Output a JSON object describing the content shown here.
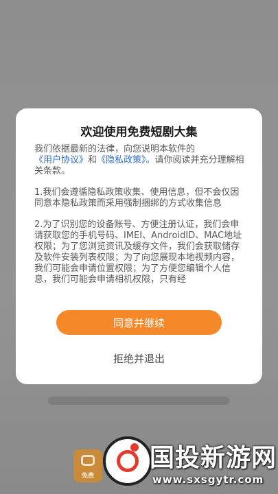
{
  "dialog": {
    "title": "欢迎使用免费短剧大集",
    "intro_before": "我们依据最新的法律，向您说明本软件的",
    "user_agreement_link": "《用户协议》",
    "and_text": "和",
    "privacy_policy_link": "《隐私政策》",
    "intro_after": "。请你阅读并充分理解相关条款。",
    "clause_1": "1.我们会遵循隐私政策收集、使用信息，但不会仅因同意本隐私政策而采用强制捆绑的方式收集信息",
    "clause_2": "2.为了识别您的设备账号、方便注册认证，我们会申请获取您的手机号码、IMEI、AndroidID、MAC地址权限；为了您浏览资讯及缓存文件，我们会获取储存及软件安装列表权限；为了向您展现本地视频内容，我们可能会申请位置权限；为了方便您编辑个人信息，我们可能会申请相机权限，只有经",
    "agree_button": "同意并继续",
    "reject_button": "拒绝并退出"
  },
  "background": {
    "app_icon_label": "免费"
  },
  "watermark": {
    "title": "国投新游网",
    "url": "www.sxsgytr.com"
  },
  "colors": {
    "accent": "#f5892a",
    "link": "#2b6fd1",
    "overlay": "#8f8f8f"
  }
}
